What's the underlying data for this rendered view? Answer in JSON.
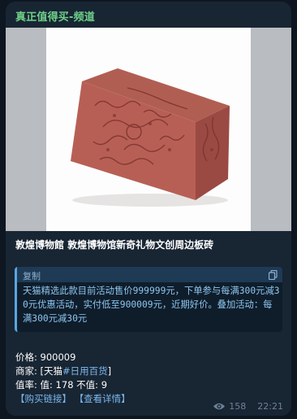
{
  "channel_name": "真正值得买-频道",
  "title": "敦煌博物館 敦煌博物馆新奇礼物文创周边板砖",
  "quote": {
    "label": "复制",
    "text": "天猫精选此款目前活动售价999999元，下单参与每满300元减30元优惠活动，实付低至900009元，近期好价。叠加活动：每满300元减30元"
  },
  "details": {
    "price_label": "价格:",
    "price_value": "900009",
    "merchant_label": "商家:",
    "merchant_value": "[天猫",
    "merchant_tag": "#日用百货",
    "merchant_close": "]",
    "rate_label": "值率:",
    "rate_value": "值: 178 不值: 9",
    "buy_link": "【购买链接】",
    "details_link": "【查看详情】"
  },
  "meta": {
    "views": "158",
    "time": "22:21"
  },
  "colors": {
    "background": "#0e1621",
    "bubble": "#182533",
    "channel_name": "#6fd08a",
    "link": "#7ab8ee",
    "quote_accent": "#5aa6e0"
  },
  "icons": {
    "copy": "copy-icon",
    "views": "eye-icon"
  }
}
